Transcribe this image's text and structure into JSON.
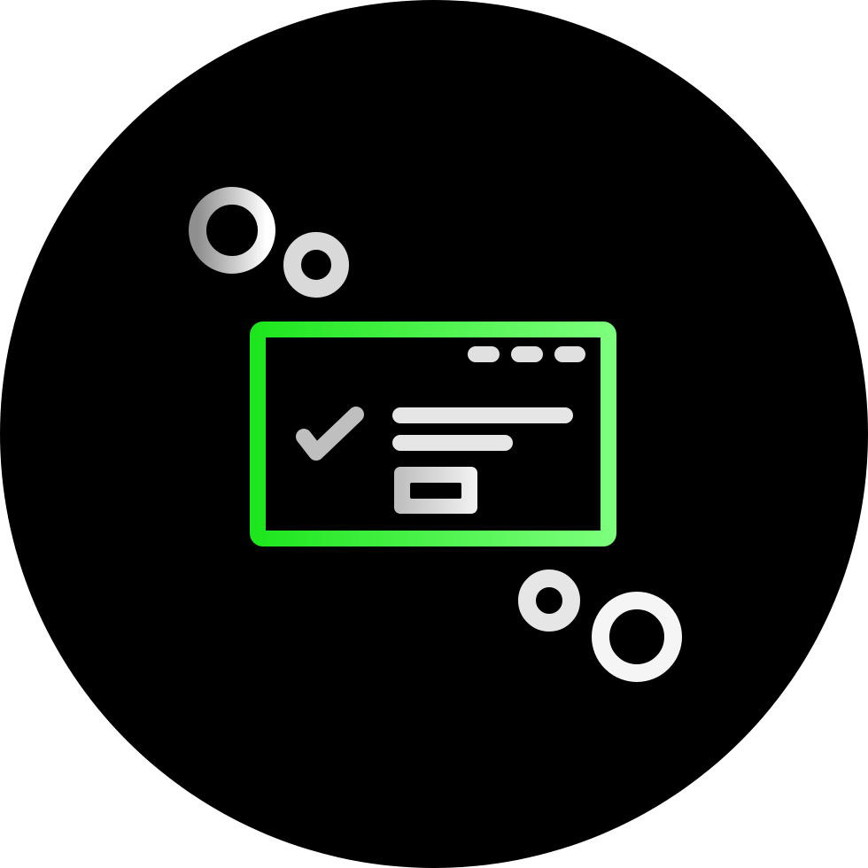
{
  "icon": {
    "name": "browser-window-approval-icon",
    "background_color": "#000000",
    "gradient_green": {
      "start": "#1ee61e",
      "end": "#7cff7c"
    },
    "gradient_gray": {
      "start": "#8f8f8f",
      "end": "#ffffff"
    },
    "elements": [
      "background-circle",
      "bubble-circles",
      "browser-window-frame",
      "window-control-dots",
      "check-mark-icon",
      "text-lines",
      "action-button"
    ]
  }
}
